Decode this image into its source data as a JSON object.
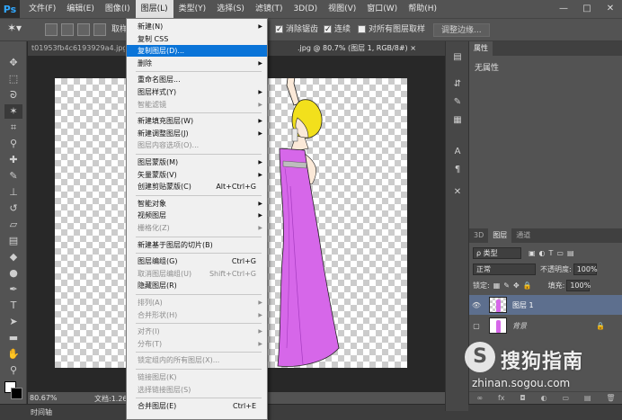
{
  "app": {
    "logo": "Ps"
  },
  "menubar": {
    "items": [
      "文件(F)",
      "编辑(E)",
      "图像(I)",
      "图层(L)",
      "类型(Y)",
      "选择(S)",
      "滤镜(T)",
      "3D(D)",
      "视图(V)",
      "窗口(W)",
      "帮助(H)"
    ],
    "active_index": 3,
    "window_buttons": [
      "—",
      "□",
      "✕"
    ]
  },
  "options_bar": {
    "partial_label": "取样",
    "anti_alias": "消除锯齿",
    "contiguous": "连续",
    "sample_all": "对所有图层取样",
    "refine_edge": "调整边缘..."
  },
  "document": {
    "tab1": "t01953fb4c6193929a4.jpg @",
    "tab2": ".jpg @ 80.7% (图层 1, RGB/8#) ×"
  },
  "statusbar": {
    "zoom": "80.67%",
    "doc_label": "文档:1.26"
  },
  "timeline": {
    "label": "时间轴"
  },
  "layer_menu": {
    "items": [
      {
        "label": "新建(N)",
        "submenu": true
      },
      {
        "label": "复制 CSS"
      },
      {
        "label": "复制图层(D)...",
        "highlighted": true
      },
      {
        "label": "删除",
        "submenu": true
      },
      {
        "sep": true
      },
      {
        "label": "重命名图层..."
      },
      {
        "label": "图层样式(Y)",
        "submenu": true
      },
      {
        "label": "智能滤镜",
        "disabled": true,
        "submenu": true
      },
      {
        "sep": true
      },
      {
        "label": "新建填充图层(W)",
        "submenu": true
      },
      {
        "label": "新建调整图层(J)",
        "submenu": true
      },
      {
        "label": "图层内容选项(O)...",
        "disabled": true
      },
      {
        "sep": true
      },
      {
        "label": "图层蒙版(M)",
        "submenu": true
      },
      {
        "label": "矢量蒙版(V)",
        "submenu": true
      },
      {
        "label": "创建剪贴蒙版(C)",
        "shortcut": "Alt+Ctrl+G"
      },
      {
        "sep": true
      },
      {
        "label": "智能对象",
        "submenu": true
      },
      {
        "label": "视频图层",
        "submenu": true
      },
      {
        "label": "栅格化(Z)",
        "disabled": true,
        "submenu": true
      },
      {
        "sep": true
      },
      {
        "label": "新建基于图层的切片(B)"
      },
      {
        "sep": true
      },
      {
        "label": "图层编组(G)",
        "shortcut": "Ctrl+G"
      },
      {
        "label": "取消图层编组(U)",
        "shortcut": "Shift+Ctrl+G",
        "disabled": true
      },
      {
        "label": "隐藏图层(R)"
      },
      {
        "sep": true
      },
      {
        "label": "排列(A)",
        "disabled": true,
        "submenu": true
      },
      {
        "label": "合并形状(H)",
        "disabled": true,
        "submenu": true
      },
      {
        "sep": true
      },
      {
        "label": "对齐(I)",
        "disabled": true,
        "submenu": true
      },
      {
        "label": "分布(T)",
        "disabled": true,
        "submenu": true
      },
      {
        "sep": true
      },
      {
        "label": "锁定组内的所有图层(X)...",
        "disabled": true
      },
      {
        "sep": true
      },
      {
        "label": "链接图层(K)",
        "disabled": true
      },
      {
        "label": "选择链接图层(S)",
        "disabled": true
      },
      {
        "sep": true
      },
      {
        "label": "合并图层(E)",
        "shortcut": "Ctrl+E"
      }
    ]
  },
  "properties_panel": {
    "tab": "属性",
    "body": "无属性"
  },
  "layers_panel": {
    "tabs": [
      "3D",
      "图层",
      "通道"
    ],
    "active_tab": 1,
    "filter_kind": "ρ 类型",
    "blend_mode": "正常",
    "opacity_label": "不透明度:",
    "opacity_value": "100%",
    "lock_label": "锁定:",
    "fill_label": "填充:",
    "fill_value": "100%",
    "layers": [
      {
        "name": "图层 1",
        "selected": true,
        "visible": true
      },
      {
        "name": "背景",
        "selected": false,
        "visible": false,
        "locked": true
      }
    ],
    "footer_icons": [
      "∞",
      "fx",
      "◘",
      "◐",
      "▭",
      "▤",
      "🗑"
    ]
  },
  "watermark": {
    "logo": "S",
    "text": "搜狗指南",
    "sub": "zhinan.sogou.com"
  },
  "colors": {
    "chrome": "#535353",
    "canvas_bg": "#282828",
    "selection_blue": "#0a74d8",
    "dress": "#d667e9",
    "hair": "#f2e01c"
  }
}
